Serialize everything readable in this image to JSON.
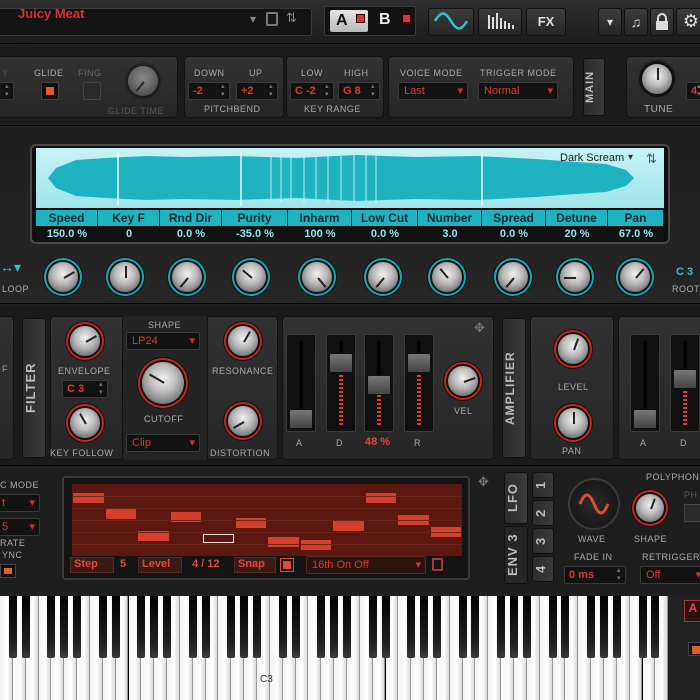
{
  "preset": {
    "name": "Juicy Meat",
    "a_label": "A",
    "b_label": "B"
  },
  "toolbar": {
    "fx_label": "FX"
  },
  "voice": {
    "glide_label": "GLIDE",
    "fing_label": "FING",
    "glide_time_label": "GLIDE TIME",
    "partial_y": "Y",
    "pb_down_label": "DOWN",
    "pb_up_label": "UP",
    "pb_down": "-2",
    "pb_up": "+2",
    "pitchbend_label": "PITCHBEND",
    "kr_low_label": "LOW",
    "kr_high_label": "HIGH",
    "kr_low": "C -2",
    "kr_high": "G 8",
    "key_range_label": "KEY RANGE",
    "voice_mode_label": "VOICE MODE",
    "voice_mode": "Last",
    "trigger_mode_label": "TRIGGER MODE",
    "trigger_mode": "Normal",
    "main_label": "MAIN",
    "tune_label": "TUNE",
    "tune_partial": "4"
  },
  "sample": {
    "name": "Dark Scream",
    "params": [
      {
        "name": "Speed",
        "value": "150.0 %"
      },
      {
        "name": "Key F",
        "value": "0"
      },
      {
        "name": "Rnd Dir",
        "value": "0.0 %"
      },
      {
        "name": "Purity",
        "value": "-35.0 %"
      },
      {
        "name": "Inharm",
        "value": "100 %"
      },
      {
        "name": "Low Cut",
        "value": "0.0 %"
      },
      {
        "name": "Number",
        "value": "3.0"
      },
      {
        "name": "Spread",
        "value": "0.0 %"
      },
      {
        "name": "Detune",
        "value": "20 %"
      },
      {
        "name": "Pan",
        "value": "67.0 %"
      }
    ],
    "loop_label": "LOOP",
    "root_label": "ROOT",
    "root_partial": "C 3"
  },
  "filter": {
    "title": "FILTER",
    "shape_label": "SHAPE",
    "shape": "LP24",
    "envelope_label": "ENVELOPE",
    "envelope_note": "C 3",
    "key_follow_label": "KEY FOLLOW",
    "cutoff_label": "CUTOFF",
    "clip": "Clip",
    "resonance_label": "RESONANCE",
    "distortion_label": "DISTORTION",
    "partial_f": "F"
  },
  "filter_env": {
    "a": "A",
    "d": "D",
    "s_value": "48 %",
    "r": "R",
    "vel_label": "VEL"
  },
  "amp": {
    "title": "AMPLIFIER",
    "level_label": "LEVEL",
    "pan_label": "PAN",
    "a": "A",
    "d": "D"
  },
  "arp": {
    "mode_label": "C MODE",
    "mode_value": "t",
    "second_value": "5",
    "rate_label": "RATE",
    "sync_label": "YNC"
  },
  "seq": {
    "step_label": "Step",
    "step_value": "5",
    "level_label": "Level",
    "level_value": "4 / 12",
    "snap_label": "Snap",
    "pattern": "16th On Off",
    "levels": [
      0.85,
      0.6,
      0.25,
      0.55,
      0.2,
      0.45,
      0.15,
      0.1,
      0.4,
      0.85,
      0.5,
      0.3
    ]
  },
  "mod": {
    "lfo_label": "LFO",
    "env3_label": "ENV 3",
    "nums": [
      "1",
      "2",
      "3",
      "4"
    ],
    "wave_label": "WAVE",
    "shape_label": "SHAPE",
    "polyphonic_label": "POLYPHONIC",
    "ph_partial": "PH",
    "fade_in_label": "FADE IN",
    "fade_in": "0 ms",
    "retrigger_label": "RETRIGGER",
    "retrigger": "Off"
  },
  "keyboard": {
    "c3_label": "C3"
  }
}
